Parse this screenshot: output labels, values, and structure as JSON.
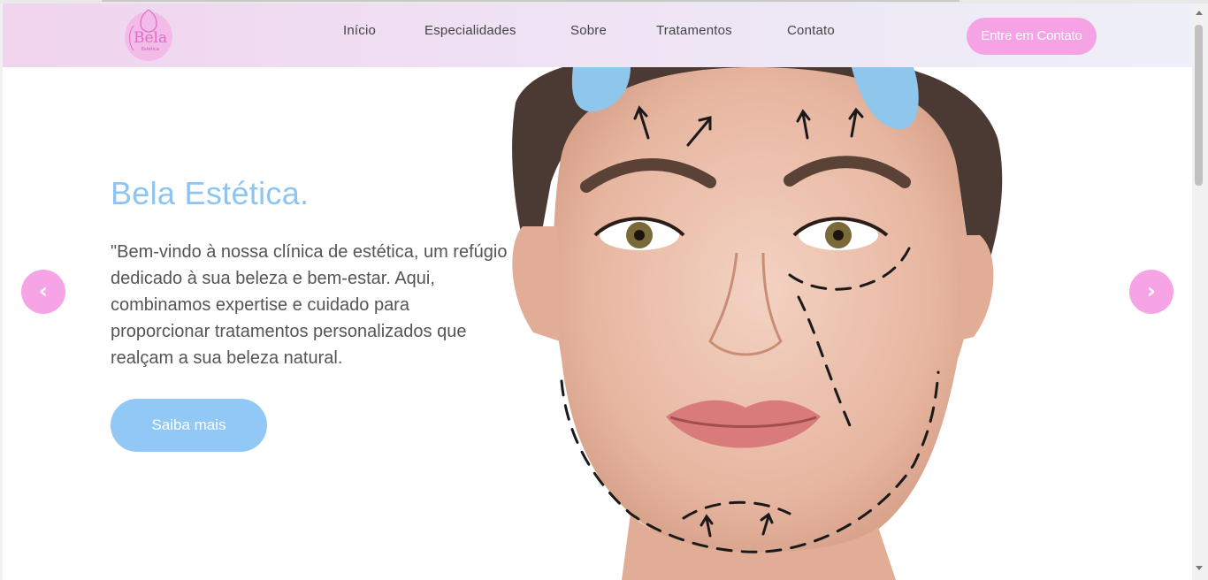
{
  "header": {
    "logo_text": "Bela",
    "logo_sub": "Estética",
    "nav": [
      {
        "label": "Início"
      },
      {
        "label": "Especialidades"
      },
      {
        "label": "Sobre"
      },
      {
        "label": "Tratamentos"
      },
      {
        "label": "Contato"
      }
    ],
    "cta_label": "Entre em Contato"
  },
  "hero": {
    "title": "Bela Estética.",
    "text": "\"Bem-vindo à nossa clínica de estética, um refúgio dedicado à sua beleza e bem-estar. Aqui, combinamos expertise e cuidado para proporcionar tratamentos personalizados que realçam a sua beleza natural.",
    "button_label": "Saiba mais",
    "image_icon": "face-with-surgical-markings"
  },
  "carousel": {
    "prev_icon": "chevron-left-icon",
    "next_icon": "chevron-right-icon",
    "prev_glyph": "‹",
    "next_glyph": "›"
  },
  "colors": {
    "accent_pink": "#f5a3e4",
    "accent_blue": "#8ec4f1",
    "text": "#555555"
  }
}
